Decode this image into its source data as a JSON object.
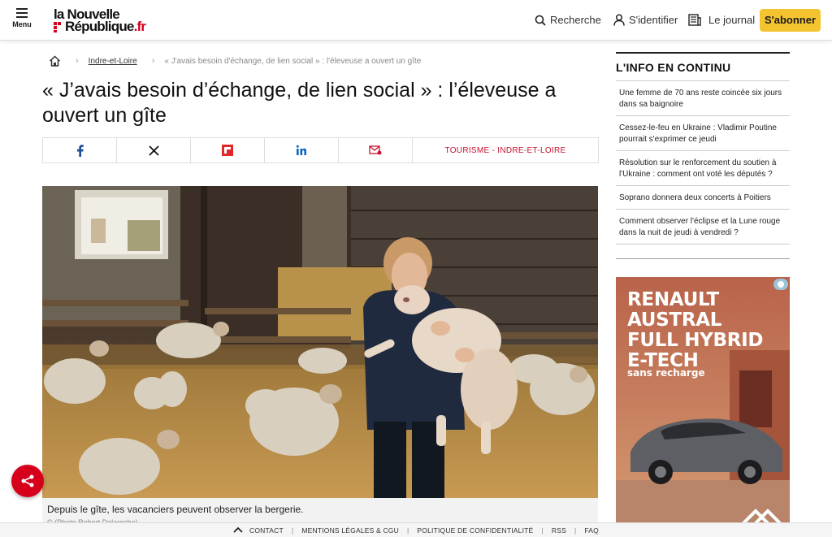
{
  "header": {
    "menu_label": "Menu",
    "logo_line1": "la Nouvelle",
    "logo_line2": "République",
    "logo_tld": ".fr",
    "search_label": "Recherche",
    "login_label": "S'identifier",
    "journal_label": "Le journal",
    "subscribe_label": "S'abonner"
  },
  "breadcrumb": {
    "section": "Indre-et-Loire",
    "current": "« J'avais besoin d'échange, de lien social » : l'éleveuse a ouvert un gîte"
  },
  "article": {
    "title": "« J’avais besoin d’échange, de lien social » : l’éleveuse a ouvert un gîte",
    "tag": "TOURISME - INDRE-ET-LOIRE",
    "caption": "Depuis le gîte, les vacanciers peuvent observer la bergerie.",
    "credit": "© (Photo Robert Delaroche)"
  },
  "sidebar": {
    "title": "L'INFO EN CONTINU",
    "items": [
      "Une femme de 70 ans reste coincée six jours dans sa baignoire",
      "Cessez-le-feu en Ukraine : Vladimir Poutine pourrait s'exprimer ce jeudi",
      "Résolution sur le renforcement du soutien à l'Ukraine : comment ont voté les députés ?",
      "Soprano donnera deux concerts à Poitiers",
      "Comment observer l'éclipse et la Lune rouge dans la nuit de jeudi à vendredi ?"
    ]
  },
  "ad": {
    "line1": "RENAULT",
    "line2": "AUSTRAL",
    "line3": "FULL HYBRID",
    "line4": "E-TECH",
    "line5": "sans recharge"
  },
  "footer": {
    "links": [
      "CONTACT",
      "MENTIONS LÉGALES & CGU",
      "POLITIQUE DE CONFIDENTIALITÉ",
      "RSS",
      "FAQ"
    ]
  },
  "colors": {
    "brand_red": "#d6001c",
    "subscribe_yellow": "#f4c430",
    "tag_red": "#c8102e"
  }
}
